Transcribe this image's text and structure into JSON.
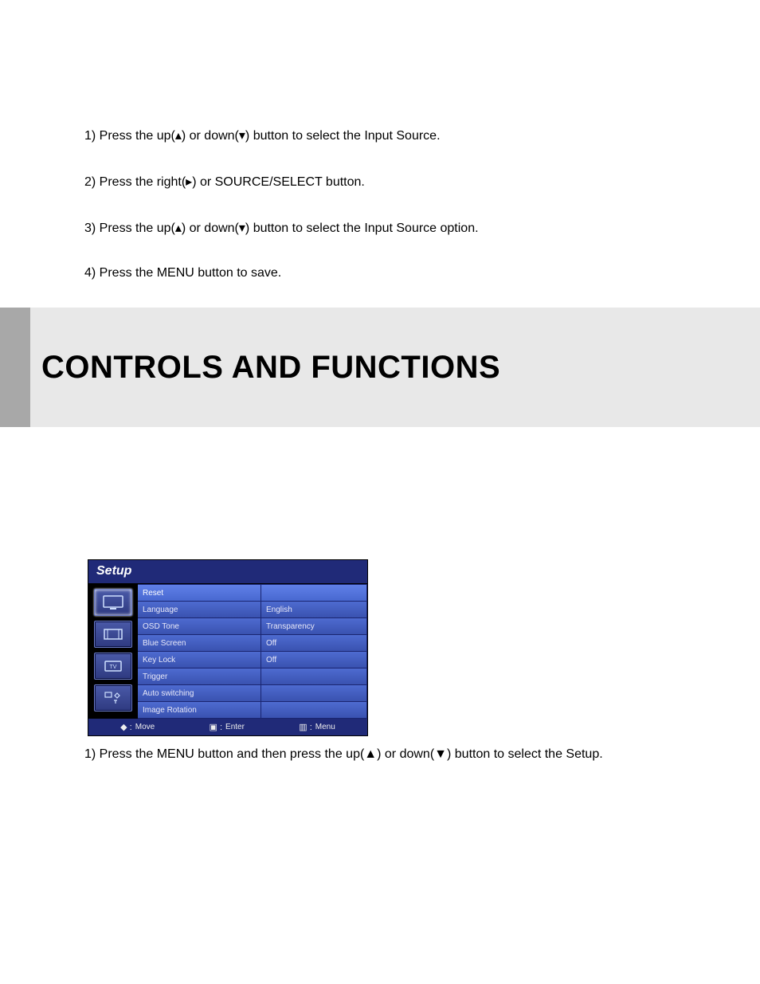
{
  "instructions": [
    "1) Press the up(▴) or down(▾) button to select the Input Source.",
    "2) Press the right(▸) or SOURCE/SELECT button.",
    "3) Press the up(▴) or down(▾) button to select the Input Source option.",
    "4) Press the MENU button to save."
  ],
  "section_heading": "CONTROLS AND FUNCTIONS",
  "osd": {
    "title": "Setup",
    "rows": [
      {
        "label": "Reset",
        "value": ""
      },
      {
        "label": "Language",
        "value": "English"
      },
      {
        "label": "OSD Tone",
        "value": "Transparency"
      },
      {
        "label": "Blue Screen",
        "value": "Off"
      },
      {
        "label": "Key Lock",
        "value": "Off"
      },
      {
        "label": "Trigger",
        "value": ""
      },
      {
        "label": "Auto switching",
        "value": ""
      },
      {
        "label": "Image Rotation",
        "value": ""
      }
    ],
    "footer": {
      "move": "Move",
      "enter": "Enter",
      "menu": "Menu",
      "move_sym": "◆ :",
      "enter_sym": "▣ :",
      "menu_sym": "▥ :"
    }
  },
  "caption": "1) Press the MENU button and then press the up(▲) or down(▼) button to select the Setup."
}
